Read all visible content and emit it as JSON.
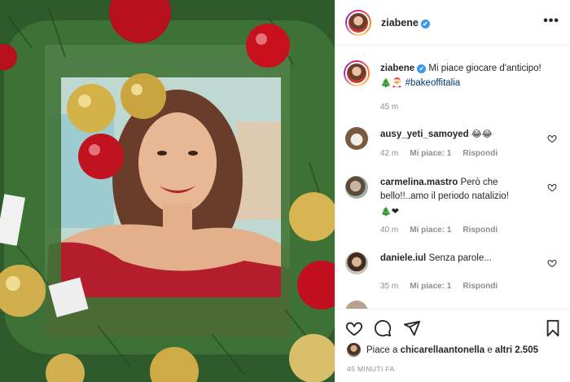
{
  "post": {
    "username": "ziabene",
    "verified_icon": "✔",
    "more_icon": "•••"
  },
  "caption": {
    "username": "ziabene",
    "text": "Mi piace giocare d'anticipo!",
    "emojis": "🎄🎅",
    "hashtag": "#bakeoffitalia",
    "time": "45 m"
  },
  "comments": [
    {
      "username": "ausy_yeti_samoyed",
      "text": "",
      "emojis": "😂😂",
      "time": "42 m",
      "likes": "Mi piace: 1",
      "reply": "Rispondi"
    },
    {
      "username": "carmelina.mastro",
      "text": "Però che bello!!..amo il periodo natalizio!",
      "emojis": "🎄❤",
      "time": "40 m",
      "likes": "Mi piace: 1",
      "reply": "Rispondi"
    },
    {
      "username": "daniele.iul",
      "text": "Senza parole...",
      "emojis": "",
      "time": "35 m",
      "likes": "Mi piace: 1",
      "reply": "Rispondi"
    }
  ],
  "actions": {
    "likes_prefix": "Piace a",
    "liked_by": "chicarellaantonella",
    "likes_joiner": "e",
    "others": "altri 2.505",
    "timestamp": "45 MINUTI FA"
  },
  "colors": {
    "link": "#00376b",
    "verified": "#3897f0",
    "muted": "#8e8e8e",
    "text": "#262626"
  }
}
